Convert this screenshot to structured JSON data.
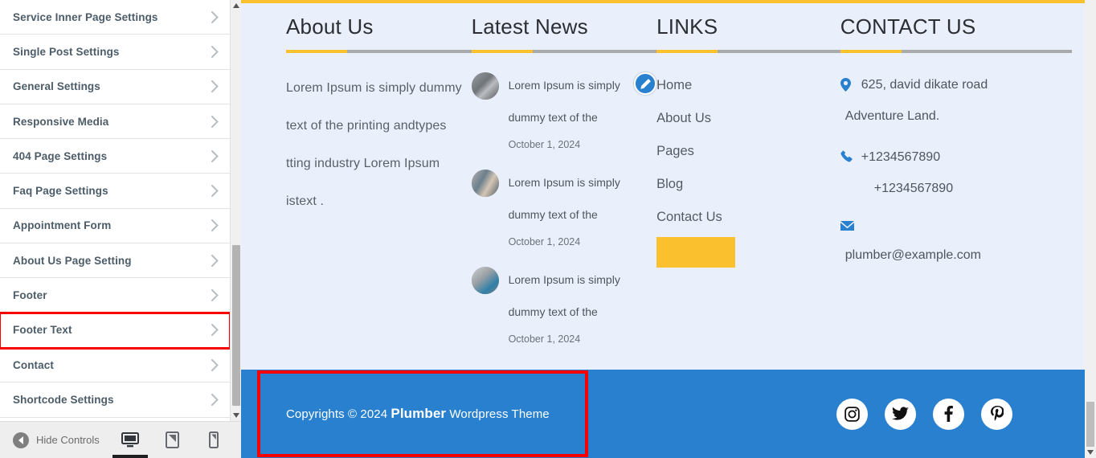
{
  "sidebar": {
    "items": [
      {
        "label": "Service Inner Page Settings",
        "highlighted": false
      },
      {
        "label": "Single Post Settings",
        "highlighted": false
      },
      {
        "label": "General Settings",
        "highlighted": false
      },
      {
        "label": "Responsive Media",
        "highlighted": false
      },
      {
        "label": "404 Page Settings",
        "highlighted": false
      },
      {
        "label": "Faq Page Settings",
        "highlighted": false
      },
      {
        "label": "Appointment Form",
        "highlighted": false
      },
      {
        "label": "About Us Page Setting",
        "highlighted": false
      },
      {
        "label": "Footer",
        "highlighted": false
      },
      {
        "label": "Footer Text",
        "highlighted": true
      },
      {
        "label": "Contact",
        "highlighted": false
      },
      {
        "label": "Shortcode Settings",
        "highlighted": false
      }
    ],
    "chevron_icon": "chevron-right-icon",
    "scroll_up_icon": "scroll-up-arrow-icon",
    "scroll_down_icon": "scroll-down-arrow-icon"
  },
  "controls": {
    "hide_controls_label": "Hide Controls",
    "back_icon": "chevron-left-icon",
    "devices": [
      {
        "name": "desktop",
        "icon": "desktop-icon",
        "active": true
      },
      {
        "name": "tablet",
        "icon": "tablet-icon",
        "active": false
      },
      {
        "name": "mobile",
        "icon": "mobile-icon",
        "active": false
      }
    ]
  },
  "preview": {
    "about": {
      "title": "About Us",
      "body": "Lorem Ipsum is simply dummy text of the printing andtypes tting industry Lorem Ipsum istext ."
    },
    "news": {
      "title": "Latest News",
      "items": [
        {
          "title": "Lorem Ipsum is simply dummy text of the",
          "date": "October 1, 2024"
        },
        {
          "title": "Lorem Ipsum is simply dummy text of the",
          "date": "October 1, 2024"
        },
        {
          "title": "Lorem Ipsum is simply dummy text of the",
          "date": "October 1, 2024"
        }
      ]
    },
    "links": {
      "title": "LINKS",
      "edit_icon": "edit-pencil-icon",
      "items": [
        {
          "label": "Home"
        },
        {
          "label": "About Us"
        },
        {
          "label": "Pages"
        },
        {
          "label": "Blog"
        },
        {
          "label": "Contact Us"
        }
      ]
    },
    "contact": {
      "title": "CONTACT US",
      "address_icon": "map-pin-icon",
      "address_line1": "625, david dikate road",
      "address_line2": "Adventure Land.",
      "phone_icon": "phone-icon",
      "phone1": "+1234567890",
      "phone2": "+1234567890",
      "email_icon": "envelope-icon",
      "email": "plumber@example.com"
    },
    "footer": {
      "copyright_prefix": "Copyrights © 2024 ",
      "brand": "Plumber",
      "copyright_suffix": " Wordpress Theme",
      "socials": [
        {
          "name": "instagram",
          "icon": "instagram-icon"
        },
        {
          "name": "twitter",
          "icon": "twitter-icon"
        },
        {
          "name": "facebook",
          "icon": "facebook-icon"
        },
        {
          "name": "pinterest",
          "icon": "pinterest-icon"
        }
      ]
    }
  },
  "colors": {
    "accent_yellow": "#fbc02d",
    "accent_blue": "#2980cf",
    "highlight_red": "#f80000",
    "page_bg": "#e9f0fb"
  }
}
